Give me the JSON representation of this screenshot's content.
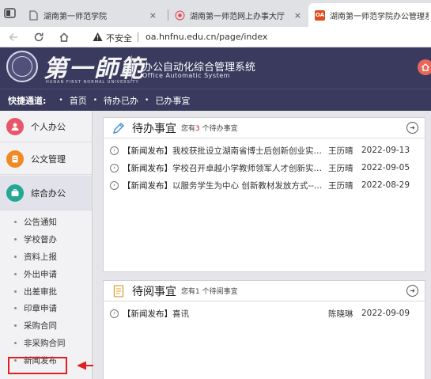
{
  "browser": {
    "tabs": [
      {
        "label": "湖南第一师范学院",
        "active": false,
        "favicon": "page-icon"
      },
      {
        "label": "湖南第一师范网上办事大厅",
        "active": false,
        "favicon": "school-seal-icon"
      },
      {
        "label": "湖南第一师范学院办公管理系统",
        "active": true,
        "favicon": "OA"
      }
    ],
    "close_glyph": "×",
    "address": {
      "security_label": "不安全",
      "url": "oa.hnfnu.edu.cn/page/index"
    }
  },
  "header": {
    "logo_text": "第一師範",
    "logo_subtext": "HUNAN FIRST NORMAL UNIVERSITY",
    "system_title": "办公自动化综合管理系统",
    "system_subtitle": "Office Automatic System"
  },
  "quicknav": {
    "label": "快捷通道:",
    "dot": "•",
    "links": [
      "首页",
      "待办已办",
      "已办事宜"
    ]
  },
  "sidebar": {
    "main_items": [
      {
        "label": "个人办公",
        "icon": "person-icon",
        "color": "#e8566a"
      },
      {
        "label": "公文管理",
        "icon": "document-icon",
        "color": "#f08a24"
      },
      {
        "label": "综合办公",
        "icon": "briefcase-icon",
        "color": "#23a896"
      }
    ],
    "sub_items": [
      "公告通知",
      "学校督办",
      "资料上报",
      "外出申请",
      "出差审批",
      "印章申请",
      "采购合同",
      "非采购合同",
      "新闻发布"
    ],
    "highlighted_sub_item": "新闻发布"
  },
  "todo_panel": {
    "title": "待办事宜",
    "count_prefix": "您有",
    "count": "3",
    "count_suffix": "个待办事宜",
    "more_glyph": "➜",
    "rows": [
      {
        "category": "【新闻发布】",
        "title": "我校获批设立湖南省博士后创新创业实践基地",
        "author": "王历晴",
        "date": "2022-09-13"
      },
      {
        "category": "【新闻发布】",
        "title": "学校召开卓越小学教师领军人才创新实验班 ...",
        "author": "王历晴",
        "date": "2022-09-05"
      },
      {
        "category": "【新闻发布】",
        "title": "以服务学生为中心 创新教材发放方式----我校...",
        "author": "王历晴",
        "date": "2022-08-29"
      }
    ]
  },
  "read_panel": {
    "title": "待阅事宜",
    "count_prefix": "您有",
    "count": "1",
    "count_suffix": "个待阅事宜",
    "more_glyph": "➜",
    "rows": [
      {
        "category": "【新闻发布】",
        "title": "喜讯",
        "author": "陈晓琳",
        "date": "2022-09-09"
      }
    ]
  },
  "row_arrow_glyph": "›",
  "colors": {
    "header_bg": "#3a3a5e",
    "highlight": "#e02020",
    "home_button": "#e8665a"
  }
}
